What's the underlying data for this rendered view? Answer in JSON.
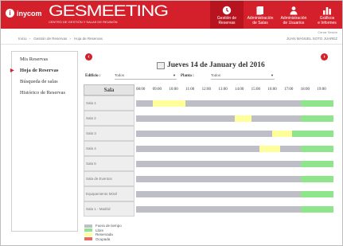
{
  "header": {
    "logo_mark": "i",
    "logo_text": "inycom",
    "brand_name": "GESMEETING",
    "brand_sub": "CENTRO DE GESTIÓN Y SALAS DE REUNIÓN",
    "nav": [
      {
        "line1": "Gestión de",
        "line2": "Reservas",
        "icon": "clock-icon",
        "active": true
      },
      {
        "line1": "Administración",
        "line2": "de Salas",
        "icon": "door-icon",
        "active": false
      },
      {
        "line1": "Administración",
        "line2": "de Usuarios",
        "icon": "user-icon",
        "active": false
      },
      {
        "line1": "Gráficos",
        "line2": "e Informes",
        "icon": "bar-chart-icon",
        "active": false
      }
    ]
  },
  "session": {
    "close": "Cerrar Sesión"
  },
  "breadcrumb": [
    "Inicio",
    "Gestión de Reservas",
    "Hoja de Reservas"
  ],
  "user": {
    "name": "JUAN MANUEL SOTO JUAREZ"
  },
  "sidebar": {
    "items": [
      {
        "label": "Mis Reservas",
        "active": false
      },
      {
        "label": "Hoja de Reservas",
        "active": true
      },
      {
        "label": "Búsqueda de salas",
        "active": false
      },
      {
        "label": "Histórico de Reservas",
        "active": false
      }
    ]
  },
  "main": {
    "date_title": "Jueves 14 de January del 2016",
    "filters": {
      "building_label": "Edificio :",
      "building_value": "Todos",
      "floor_label": "Planta :",
      "floor_value": "Todos"
    },
    "grid": {
      "sala_header": "Sala",
      "hours": [
        "08:00",
        "09:00",
        "10:00",
        "11:00",
        "12:00",
        "13:00",
        "14:00",
        "15:00",
        "16:00",
        "17:00",
        "18:00",
        "19:00"
      ],
      "rooms": [
        {
          "name": "Sala 1",
          "segments": [
            [
              "fuera",
              8,
              9
            ],
            [
              "reservada",
              9,
              11
            ],
            [
              "fuera",
              11,
              18
            ],
            [
              "libre",
              18,
              20
            ]
          ]
        },
        {
          "name": "Sala 2",
          "segments": [
            [
              "fuera",
              8,
              14
            ],
            [
              "reservada",
              14,
              15
            ],
            [
              "fuera",
              15,
              18
            ],
            [
              "libre",
              18,
              20
            ]
          ]
        },
        {
          "name": "Sala 3",
          "segments": [
            [
              "fuera",
              8,
              16.25
            ],
            [
              "reservada",
              16.25,
              17.5
            ],
            [
              "libre",
              17.5,
              20
            ]
          ]
        },
        {
          "name": "Sala 4",
          "segments": [
            [
              "fuera",
              8,
              15.5
            ],
            [
              "reservada",
              15.5,
              16.75
            ],
            [
              "fuera",
              16.75,
              18
            ],
            [
              "libre",
              18,
              20
            ]
          ]
        },
        {
          "name": "Sala 5",
          "segments": [
            [
              "fuera",
              8,
              18
            ],
            [
              "libre",
              18,
              20
            ]
          ]
        },
        {
          "name": "Sala de Eventos",
          "segments": [
            [
              "fuera",
              8,
              18
            ],
            [
              "libre",
              18,
              20
            ]
          ]
        },
        {
          "name": "Equipamiento Móvil",
          "segments": [
            [
              "fuera",
              8,
              18
            ],
            [
              "libre",
              18,
              20
            ]
          ]
        },
        {
          "name": "Sala 1 - Madrid",
          "segments": [
            [
              "fuera",
              8,
              18
            ],
            [
              "libre",
              18,
              20
            ]
          ]
        }
      ]
    },
    "legend": [
      {
        "label": "Fuera de tiempo",
        "key": "fuera"
      },
      {
        "label": "Libre",
        "key": "libre"
      },
      {
        "label": "Reservada",
        "key": "reservada"
      },
      {
        "label": "Ocupada",
        "key": "ocupada"
      }
    ]
  },
  "colors": {
    "brand": "#d3202b",
    "fuera": "#bdbec6",
    "libre": "#8ee58b",
    "reservada": "#ffff99",
    "ocupada": "#e36b6b"
  }
}
